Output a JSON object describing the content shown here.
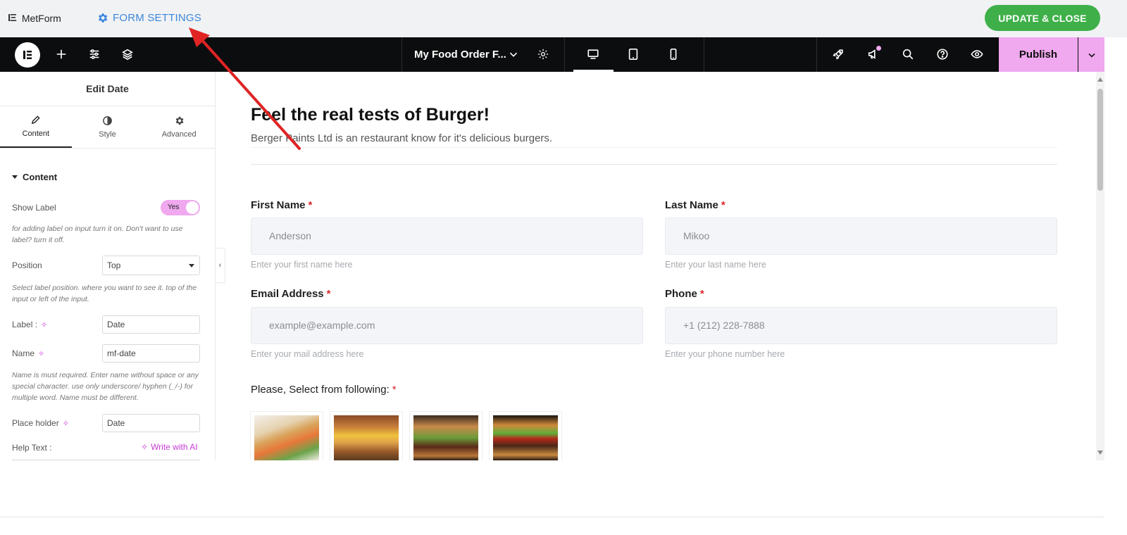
{
  "metform_bar": {
    "logo_mark": "IΞ",
    "app_name": "MetForm",
    "settings_label": "FORM SETTINGS",
    "update_button": "UPDATE & CLOSE"
  },
  "elementor_bar": {
    "document_title": "My Food Order F...",
    "publish_label": "Publish",
    "icons": [
      "elementor-logo-icon",
      "add-element-icon",
      "site-settings-icon",
      "structure-layers-icon",
      "chevron-down-icon",
      "page-settings-gear-icon",
      "desktop-view-icon",
      "tablet-view-icon",
      "mobile-view-icon",
      "rocket-icon",
      "notifications-megaphone-icon",
      "search-icon",
      "help-icon",
      "preview-eye-icon"
    ]
  },
  "panel": {
    "title": "Edit Date",
    "tabs": [
      {
        "label": "Content",
        "icon": "pencil-icon"
      },
      {
        "label": "Style",
        "icon": "contrast-icon"
      },
      {
        "label": "Advanced",
        "icon": "gear-icon"
      }
    ],
    "section_title": "Content",
    "show_label": {
      "label": "Show Label",
      "value": "Yes",
      "help": "for adding label on input turn it on. Don't want to use label? turn it off."
    },
    "position": {
      "label": "Position",
      "value": "Top",
      "help": "Select label position. where you want to see it. top of the input or left of the input."
    },
    "label_field": {
      "label": "Label :",
      "value": "Date"
    },
    "name_field": {
      "label": "Name",
      "value": "mf-date",
      "help": "Name is must required. Enter name without space or any special character. use only underscore/ hyphen (_/-) for multiple word. Name must be different."
    },
    "placeholder_field": {
      "label": "Place holder",
      "value": "Date"
    },
    "help_text": {
      "label": "Help Text :",
      "ai_label": "Write with AI"
    }
  },
  "form": {
    "title": "Feel the real tests of Burger!",
    "subtitle": "Berger Paints Ltd is an restaurant know for it's delicious burgers.",
    "required_mark": "*",
    "fields": {
      "first_name": {
        "label": "First Name",
        "value": "Anderson",
        "help": "Enter your first name here"
      },
      "last_name": {
        "label": "Last Name",
        "value": "Mikoo",
        "help": "Enter your last name here"
      },
      "email": {
        "label": "Email Address",
        "value": "example@example.com",
        "help": "Enter your mail address here"
      },
      "phone": {
        "label": "Phone",
        "value": "+1 (212) 228-7888",
        "help": "Enter your phone number here"
      }
    },
    "select_label": "Please, Select from following:"
  },
  "colors": {
    "accent_pink": "#f0a8ef",
    "update_green": "#3fb049",
    "settings_blue": "#3b87dc",
    "required_red": "#d9272b",
    "annotation_arrow": "#e02424"
  }
}
